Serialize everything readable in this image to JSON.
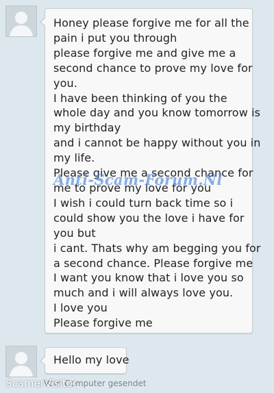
{
  "messages": [
    {
      "sender_avatar": "default-user-avatar",
      "lines": [
        "Honey please forgive me for all the",
        "pain i put you through",
        "please forgive me and give me a",
        "second chance to prove my love for",
        "you.",
        "I have been thinking of you the",
        "whole day and you know tomorrow is",
        "my birthday",
        "and i cannot be happy without you in",
        "my life.",
        "Please give me a second chance for",
        "me to prove my love for you",
        "I wish i could turn back time so i",
        "could show you the love i have for",
        "you but",
        "i cant. Thats why am begging you for",
        "a second chance. Please forgive me",
        "I want you know that i love you so",
        "much and i will always love you.",
        " I love you",
        "Please forgive me"
      ]
    },
    {
      "sender_avatar": "default-user-avatar",
      "lines": [
        "Hello my love"
      ]
    }
  ],
  "watermark": "Anti-Scam-Forum.Nl",
  "footer": {
    "source_label": "ScamerVisitor",
    "status": "Vom Computer gesendet"
  },
  "colors": {
    "background": "#dce8ee",
    "bubble": "#f7f8f7",
    "watermark": "#5b8fe0"
  }
}
